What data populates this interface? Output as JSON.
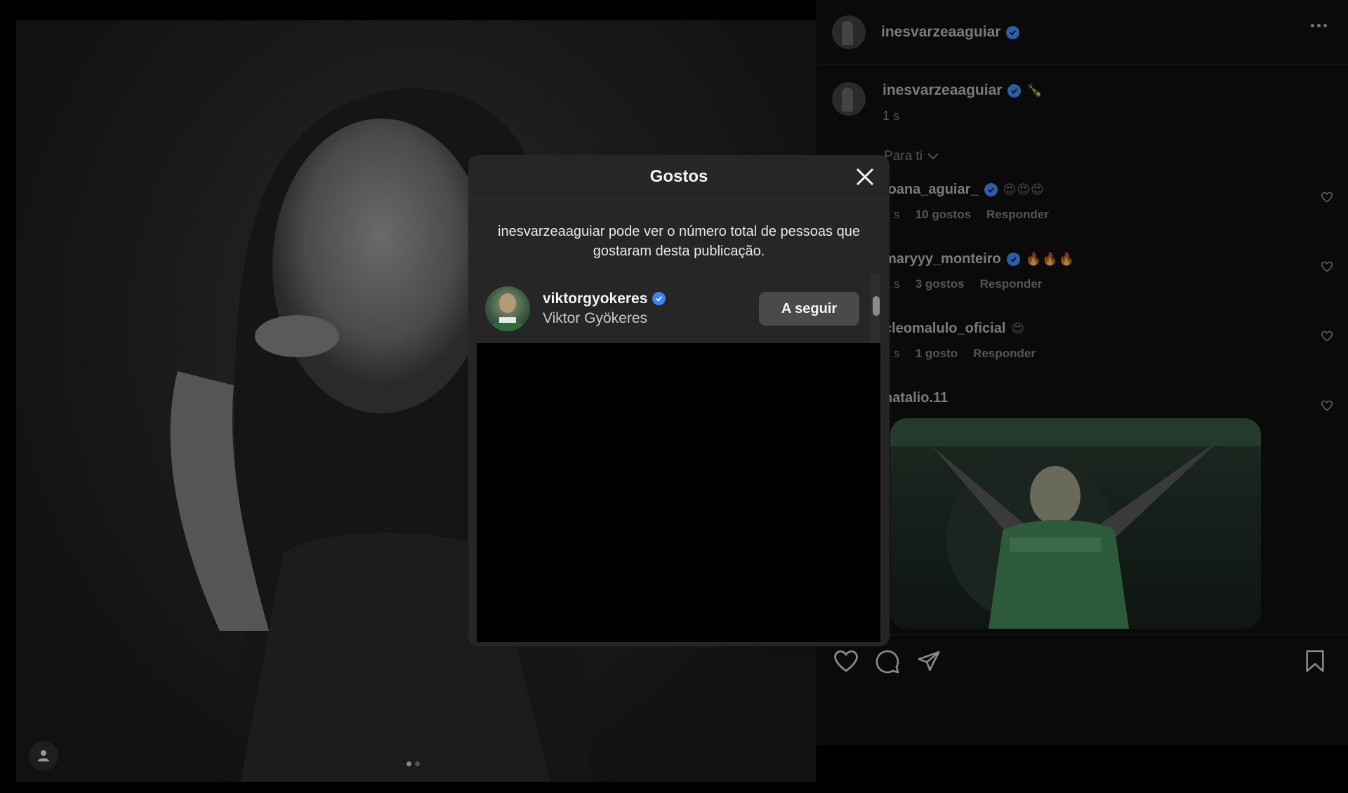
{
  "post": {
    "username": "inesvarzeaaguiar",
    "caption_emoji": "🍾",
    "caption_time": "1 s",
    "carousel": {
      "total": 2,
      "active": 1
    }
  },
  "comments": {
    "sort_label": "Para ti",
    "items": [
      {
        "user": "joana_aguiar_",
        "emojis": "😍😍😍",
        "time": "1 s",
        "likes": "10 gostos",
        "reply": "Responder"
      },
      {
        "user": "maryyy_monteiro",
        "emojis": "🔥🔥🔥",
        "time": "1 s",
        "likes": "3 gostos",
        "reply": "Responder"
      },
      {
        "user": "cleomalulo_oficial",
        "emojis": "😍",
        "time": "1 s",
        "likes": "1 gosto",
        "reply": "Responder"
      },
      {
        "user": "natalio.11",
        "emojis": ""
      }
    ]
  },
  "modal": {
    "title": "Gostos",
    "note": "inesvarzeaaguiar pode ver o número total de pessoas que gostaram desta publicação.",
    "likers": [
      {
        "username": "viktorgyokeres",
        "full_name": "Viktor Gyökeres",
        "button": "A seguir"
      }
    ]
  },
  "icons": {
    "verified": "verified-badge-icon",
    "close": "close-icon",
    "heart": "heart-icon",
    "comment": "comment-icon",
    "share": "share-icon",
    "save": "bookmark-icon",
    "more": "more-icon",
    "user_tag": "user-tag-icon",
    "chevron": "chevron-down-icon"
  },
  "colors": {
    "verified": "#3b82f6",
    "modal_bg": "#262626",
    "follow_btn": "#4a4a4a"
  }
}
